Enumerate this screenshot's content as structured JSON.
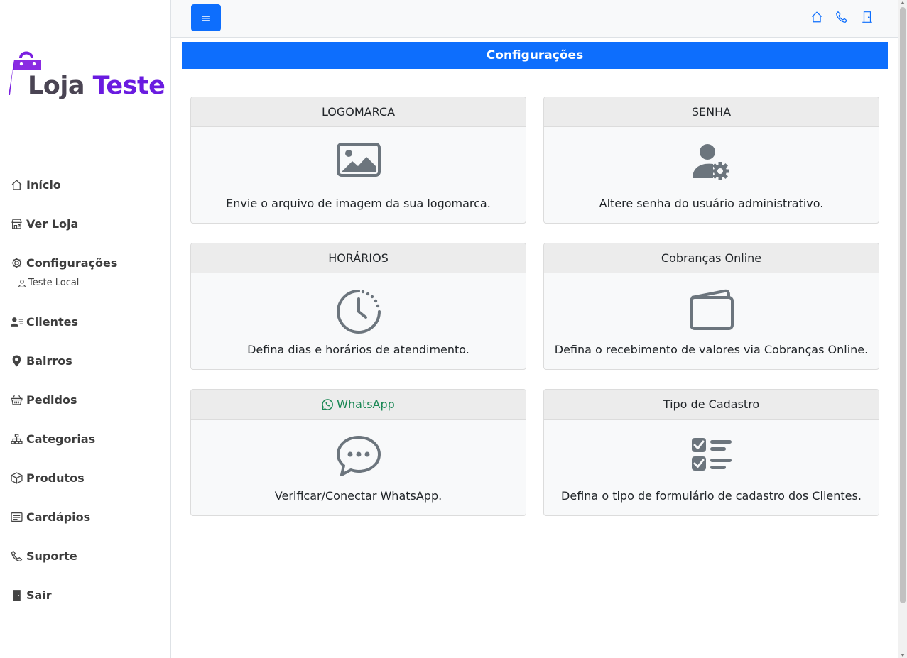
{
  "brand": {
    "word1": "Loja",
    "word2": "Teste"
  },
  "sidebar": {
    "items": [
      {
        "label": "Início",
        "icon": "home-icon"
      },
      {
        "label": "Ver Loja",
        "icon": "store-icon"
      },
      {
        "label": "Configurações",
        "icon": "gear-icon"
      },
      {
        "label": "Clientes",
        "icon": "users-list-icon"
      },
      {
        "label": "Bairros",
        "icon": "map-pin-icon"
      },
      {
        "label": "Pedidos",
        "icon": "basket-icon"
      },
      {
        "label": "Categorias",
        "icon": "diagram-icon"
      },
      {
        "label": "Produtos",
        "icon": "box-icon"
      },
      {
        "label": "Cardápios",
        "icon": "menu-card-icon"
      },
      {
        "label": "Suporte",
        "icon": "phone-icon"
      },
      {
        "label": "Sair",
        "icon": "door-icon"
      }
    ],
    "sub_item": {
      "label": "Teste Local",
      "icon": "person-icon"
    }
  },
  "topbar": {
    "menu_label": "≡",
    "icons": [
      "home-icon",
      "phone-icon",
      "door-icon"
    ]
  },
  "page": {
    "title": "Configurações"
  },
  "cards": [
    {
      "title": "LOGOMARCA",
      "icon": "image-icon",
      "text": "Envie o arquivo de imagem da sua logomarca."
    },
    {
      "title": "SENHA",
      "icon": "user-gear-icon",
      "text": "Altere senha do usuário administrativo."
    },
    {
      "title": "HORÁRIOS",
      "icon": "clock-icon",
      "text": "Defina dias e horários de atendimento."
    },
    {
      "title": "Cobranças Online",
      "icon": "wallet-icon",
      "text": "Defina o recebimento de valores via Cobranças Online."
    },
    {
      "title": "WhatsApp",
      "icon": "chat-dots-icon",
      "text": "Verificar/Conectar WhatsApp."
    },
    {
      "title": "Tipo de Cadastro",
      "icon": "checklist-icon",
      "text": "Defina o tipo de formulário de cadastro dos Clientes."
    }
  ],
  "colors": {
    "primary": "#0d6efd",
    "brand_purple": "#6a1be0",
    "whatsapp_green": "#198754",
    "icon_gray": "#6c757d"
  }
}
